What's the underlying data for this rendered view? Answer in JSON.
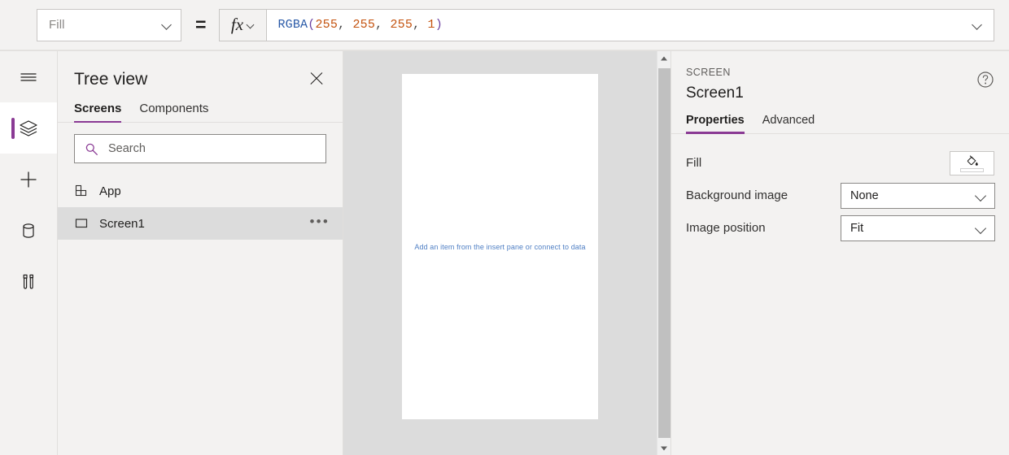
{
  "formula_bar": {
    "property_selector": {
      "value": "Fill",
      "icon": "chevron-down-icon"
    },
    "equals": "=",
    "fx_label": "fx",
    "formula_tokens": [
      {
        "text": "RGBA",
        "type": "fn"
      },
      {
        "text": "(",
        "type": "paren"
      },
      {
        "text": "255",
        "type": "num"
      },
      {
        "text": ", ",
        "type": "punct"
      },
      {
        "text": "255",
        "type": "num"
      },
      {
        "text": ", ",
        "type": "punct"
      },
      {
        "text": "255",
        "type": "num"
      },
      {
        "text": ", ",
        "type": "punct"
      },
      {
        "text": "1",
        "type": "num"
      },
      {
        "text": ")",
        "type": "paren"
      }
    ],
    "formula_plain": "RGBA(255, 255, 255, 1)"
  },
  "rail": {
    "items": [
      {
        "name": "hamburger-menu-icon",
        "label": "Menu",
        "selected": false
      },
      {
        "name": "layers-icon",
        "label": "Tree view",
        "selected": true
      },
      {
        "name": "plus-icon",
        "label": "Insert",
        "selected": false
      },
      {
        "name": "database-icon",
        "label": "Data",
        "selected": false
      },
      {
        "name": "tools-icon",
        "label": "Settings",
        "selected": false
      }
    ],
    "selected_indicator_color": "#8a3a94"
  },
  "tree_view": {
    "title": "Tree view",
    "close_icon": "close-icon",
    "tabs": [
      {
        "label": "Screens",
        "active": true
      },
      {
        "label": "Components",
        "active": false
      }
    ],
    "search": {
      "placeholder": "Search",
      "value": "",
      "icon": "search-icon"
    },
    "items": [
      {
        "label": "App",
        "icon": "app-grid-icon",
        "selected": false,
        "more": ""
      },
      {
        "label": "Screen1",
        "icon": "screen-rect-icon",
        "selected": true,
        "more": "•••"
      }
    ],
    "active_tab_color": "#8a3a94",
    "selected_row_color": "#dcdcdc"
  },
  "canvas": {
    "hint_text": "Add an item from the insert pane or connect to data",
    "hint_color": "#4f7fc4",
    "screen_fill": "#ffffff",
    "background": "#dcdcdc",
    "scrollbar": {
      "up_icon": "scroll-up-arrow-icon",
      "down_icon": "scroll-down-arrow-icon",
      "thumb": "scrollbar-thumb"
    }
  },
  "properties_panel": {
    "kicker": "SCREEN",
    "title": "Screen1",
    "help_icon": "help-circle-icon",
    "tabs": [
      {
        "label": "Properties",
        "active": true
      },
      {
        "label": "Advanced",
        "active": false
      }
    ],
    "rows": [
      {
        "label": "Fill",
        "control": "color-swatch",
        "value": "#ffffff",
        "icon": "paint-bucket-icon"
      },
      {
        "label": "Background image",
        "control": "dropdown",
        "value": "None"
      },
      {
        "label": "Image position",
        "control": "dropdown",
        "value": "Fit"
      }
    ],
    "active_tab_color": "#8a3a94"
  }
}
